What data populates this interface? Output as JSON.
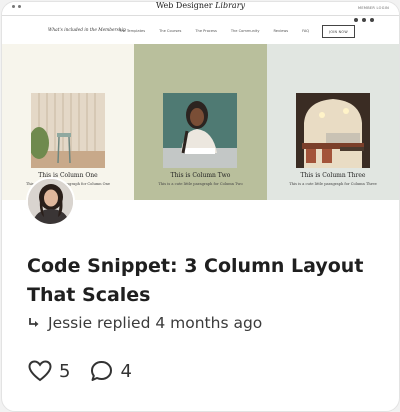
{
  "preview": {
    "site_title_plain": "Web Designer ",
    "site_title_italic": "Library",
    "member_login": "MEMBER LOGIN",
    "nav_title": "What's included in the Membership",
    "nav_items": [
      "The Templates",
      "The Courses",
      "The Process",
      "The Community",
      "Reviews",
      "FAQ"
    ],
    "join_button": "JOIN NOW",
    "columns": [
      {
        "title": "This is Column One",
        "text": "This is a cute little paragraph for Column One",
        "bg": "#f7f5ec"
      },
      {
        "title": "This is Column Two",
        "text": "This is a cute little paragraph for Column Two",
        "bg": "#b9bf9c"
      },
      {
        "title": "This is Column Three",
        "text": "This is a cute little paragraph for Column Three",
        "bg": "#e1e6e1"
      }
    ]
  },
  "post": {
    "title": "Code Snippet: 3 Column Layout That Scales",
    "meta": "Jessie replied 4 months ago"
  },
  "stats": {
    "likes": "5",
    "comments": "4"
  }
}
